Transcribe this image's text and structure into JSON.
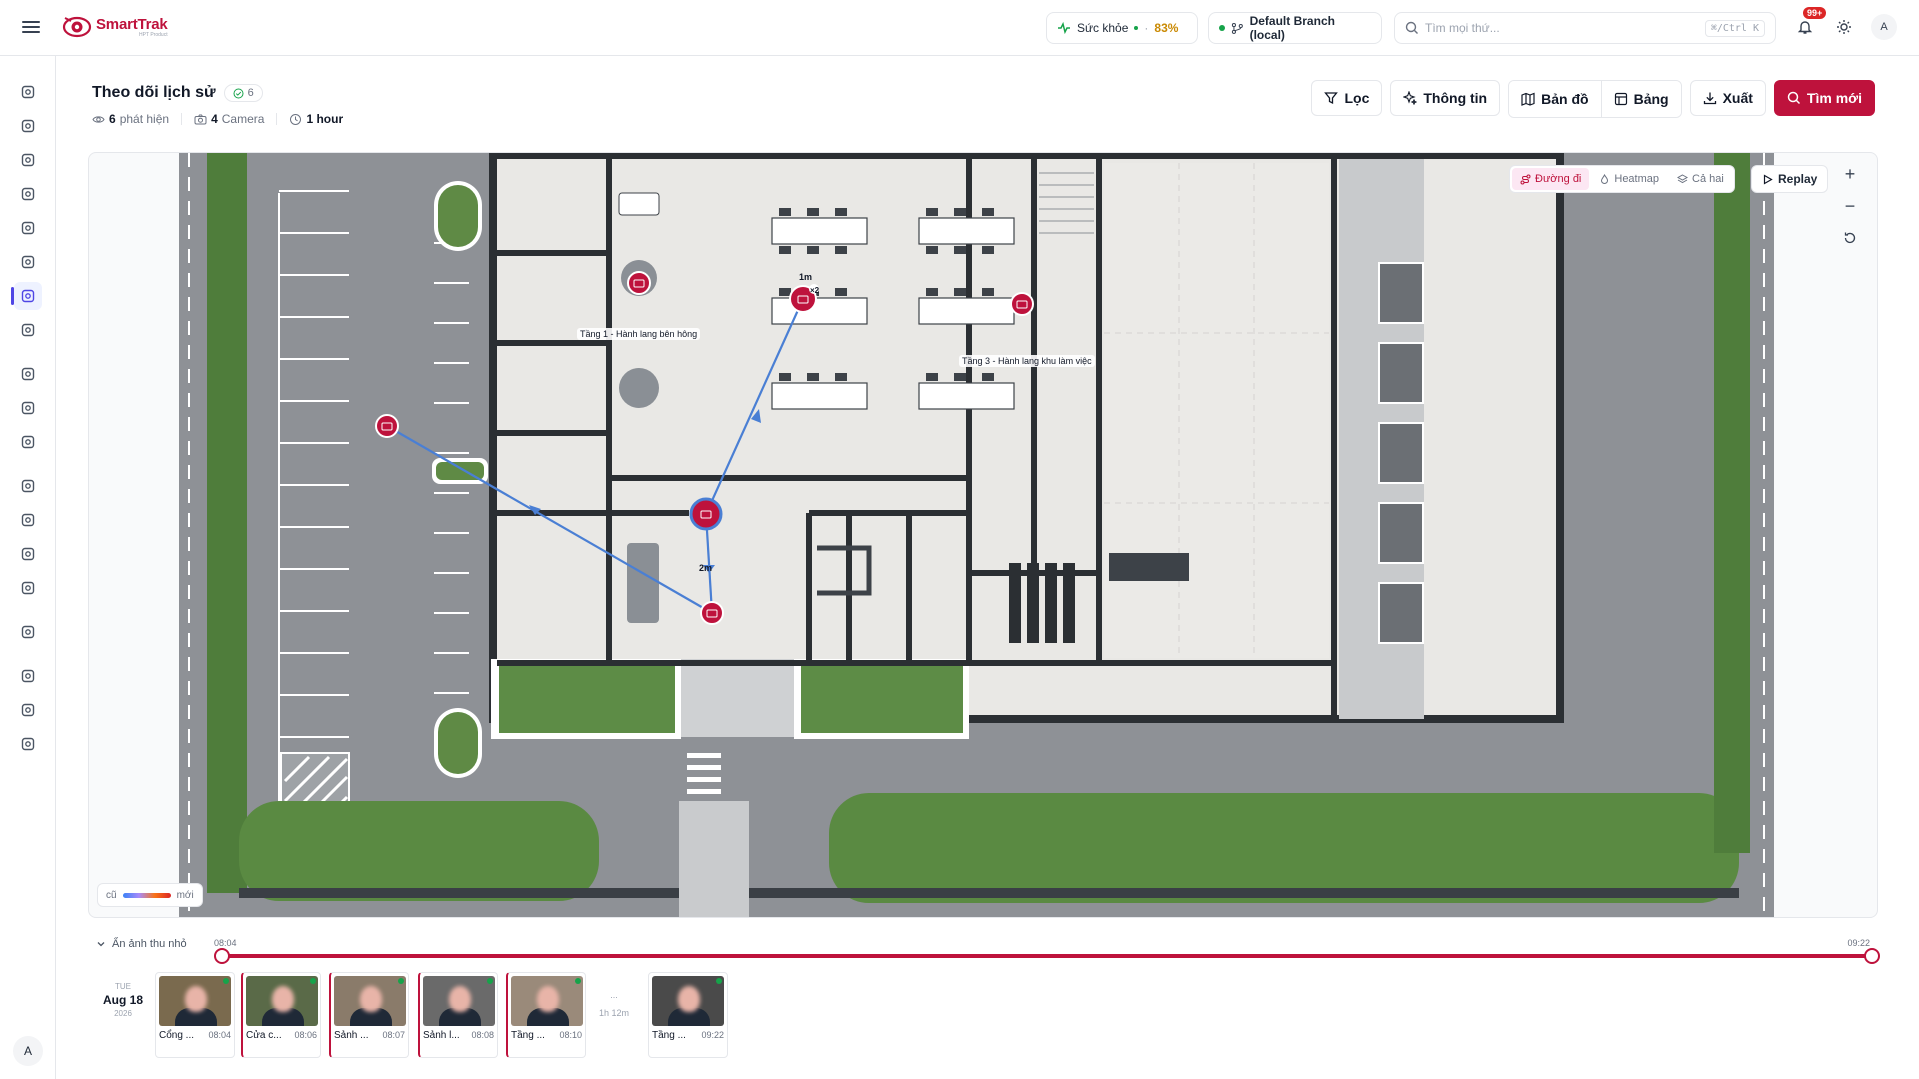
{
  "app": {
    "name": "SmartTrak",
    "tagline": "HPT Product"
  },
  "topbar": {
    "health_label": "Sức khỏe",
    "health_value": "83%",
    "branch": "Default Branch (local)",
    "search_placeholder": "Tìm mọi thứ...",
    "search_shortcut": "⌘/Ctrl K",
    "notification_count": "99+",
    "avatar_initial": "A"
  },
  "sidebar": {
    "items": [
      "dashboard-icon",
      "camera-icon",
      "face-scan-icon",
      "focus-icon",
      "detection-icon",
      "vehicle-icon",
      "history-track-icon",
      "ai-sparkle-icon",
      "folder-icon",
      "calendar-icon",
      "car-icon",
      "checklist-icon",
      "bell-icon",
      "shield-icon",
      "alarm-icon",
      "book-icon",
      "users-icon",
      "transfer-icon",
      "settings-icon"
    ],
    "active_index": 6,
    "avatar_initial": "A"
  },
  "header": {
    "title": "Theo dõi lịch sử",
    "count": "6",
    "detections_value": "6",
    "detections_label": "phát hiện",
    "cameras_value": "4",
    "cameras_label": "Camera",
    "duration": "1 hour"
  },
  "toolbar": {
    "filter": "Lọc",
    "info": "Thông tin",
    "map": "Bản đồ",
    "table": "Bảng",
    "export": "Xuất",
    "new_search": "Tìm mới"
  },
  "map": {
    "modes": [
      "Đường đi",
      "Heatmap",
      "Cả hai"
    ],
    "active_mode": "Đường đi",
    "replay": "Replay",
    "zoom_in": "+",
    "zoom_out": "−",
    "legend_old": "cũ",
    "legend_new": "mới",
    "camera_labels": {
      "cam1": "Tầng 1 - Hành lang bên hông",
      "cam3": "Tầng 3 - Hành lang khu làm việc"
    },
    "dwell": {
      "d1": "1m",
      "d2": "2m"
    },
    "visit_count": "×2",
    "colors": {
      "accent": "#be123c",
      "path": "#4a7fd4"
    }
  },
  "timeline": {
    "toggle": "Ẩn ảnh thu nhỏ",
    "start": "08:04",
    "end": "09:22",
    "date": {
      "dow": "TUE",
      "md": "Aug 18",
      "year": "2026"
    },
    "gap": {
      "dots": "...",
      "duration": "1h 12m"
    },
    "detections": [
      {
        "label": "Cổng ...",
        "time": "08:04",
        "bg": "#7a6a4e"
      },
      {
        "label": "Cửa c...",
        "time": "08:06",
        "bg": "#5a6a48"
      },
      {
        "label": "Sảnh ...",
        "time": "08:07",
        "bg": "#8a7b6a"
      },
      {
        "label": "Sảnh l...",
        "time": "08:08",
        "bg": "#6a6a6a"
      },
      {
        "label": "Tầng ...",
        "time": "08:10",
        "bg": "#9a8a7a"
      },
      {
        "label": "Tầng ...",
        "time": "09:22",
        "bg": "#4a4a4a"
      }
    ]
  }
}
